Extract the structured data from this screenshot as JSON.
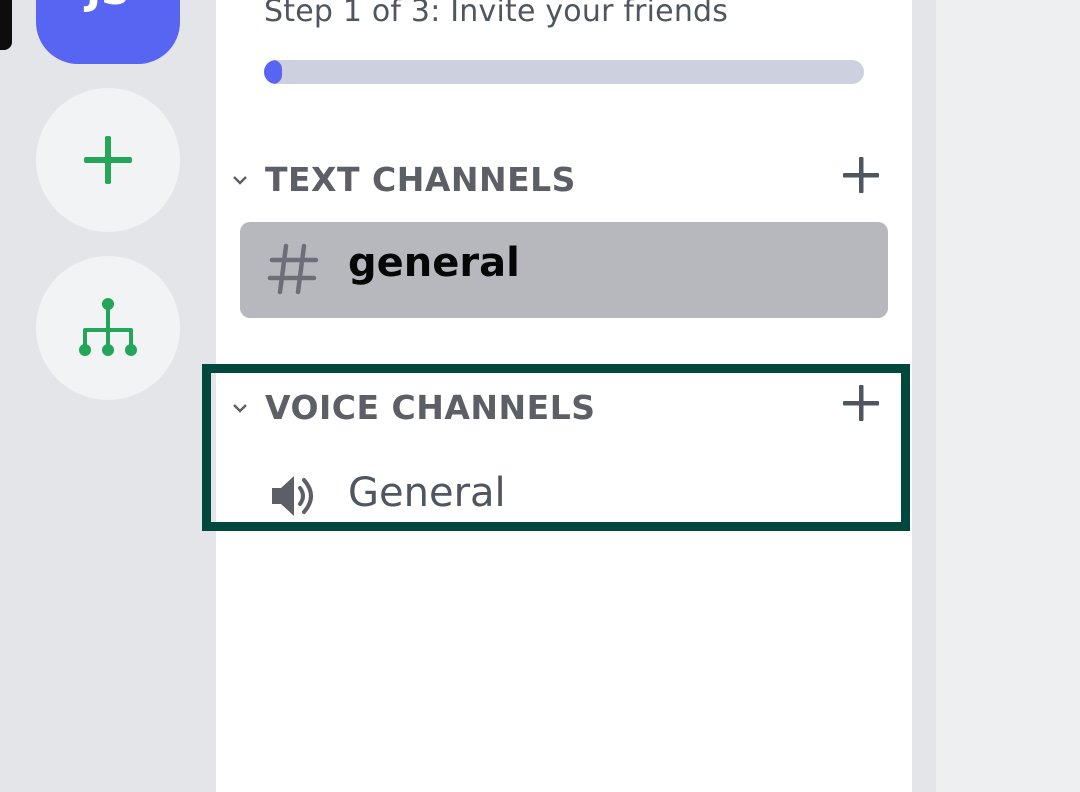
{
  "server_rail": {
    "current_server_initials": "JS",
    "add_server_icon": "plus-icon",
    "discover_icon": "hierarchy-icon"
  },
  "onboarding": {
    "step_label": "Step 1 of 3: Invite your friends",
    "progress": 0.03
  },
  "categories": {
    "text": {
      "title": "TEXT CHANNELS",
      "channels": [
        {
          "name": "general",
          "icon": "hash-icon",
          "selected": true
        }
      ]
    },
    "voice": {
      "title": "VOICE CHANNELS",
      "channels": [
        {
          "name": "General",
          "icon": "speaker-icon"
        }
      ]
    }
  },
  "colors": {
    "brand": "#5865f2",
    "green": "#23a55a",
    "highlight_border": "#00483d",
    "selected_bg": "#b6b8bd"
  }
}
